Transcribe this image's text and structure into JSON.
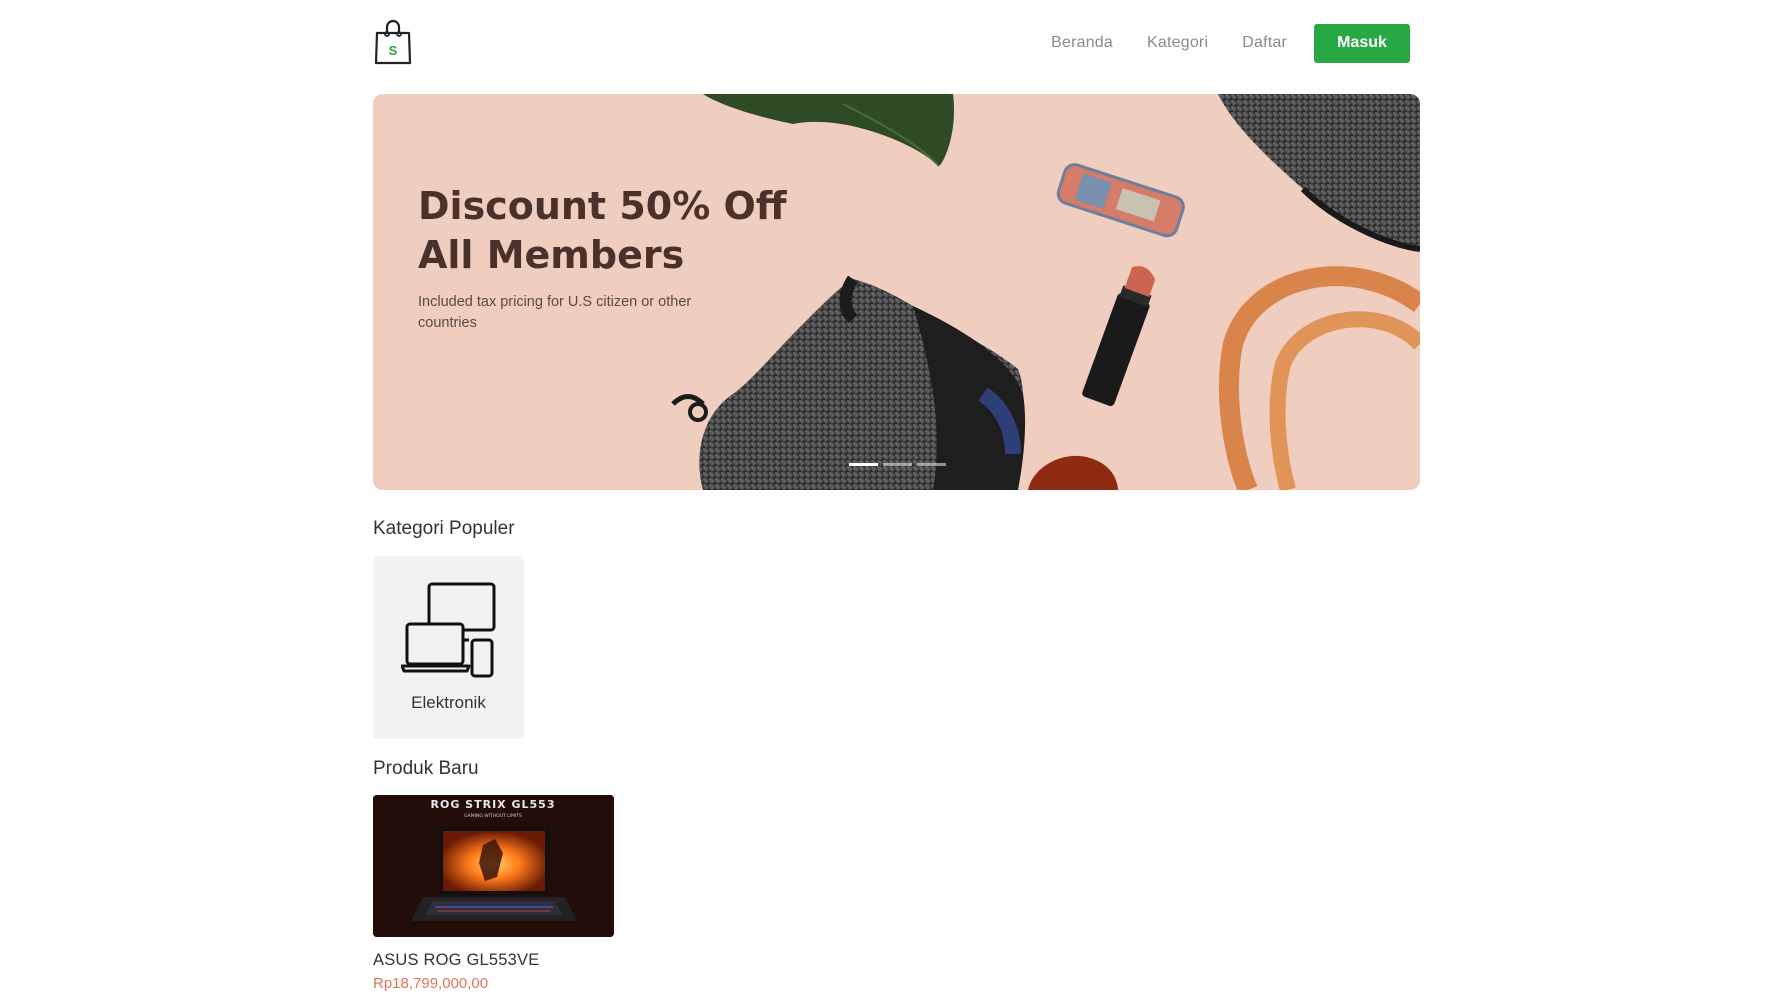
{
  "navbar": {
    "logo_letter": "S",
    "links": [
      "Beranda",
      "Kategori",
      "Daftar"
    ],
    "login_label": "Masuk",
    "accent_color": "#28a745"
  },
  "hero": {
    "title": "Discount 50% Off\nAll Members",
    "subtitle": "Included tax pricing for U.S citizen or other countries",
    "slides_total": 3,
    "active_slide": 1
  },
  "categories": {
    "title": "Kategori Populer",
    "items": [
      {
        "label": "Elektronik",
        "icon": "devices-icon"
      }
    ]
  },
  "products": {
    "title": "Produk Baru",
    "items": [
      {
        "image_caption": "ROG STRIX GL553",
        "image_tagline": "GAMING WITHOUT LIMITS",
        "name": "ASUS ROG GL553VE",
        "price": "Rp18,799,000,00",
        "price_color": "#e0735a"
      }
    ]
  }
}
